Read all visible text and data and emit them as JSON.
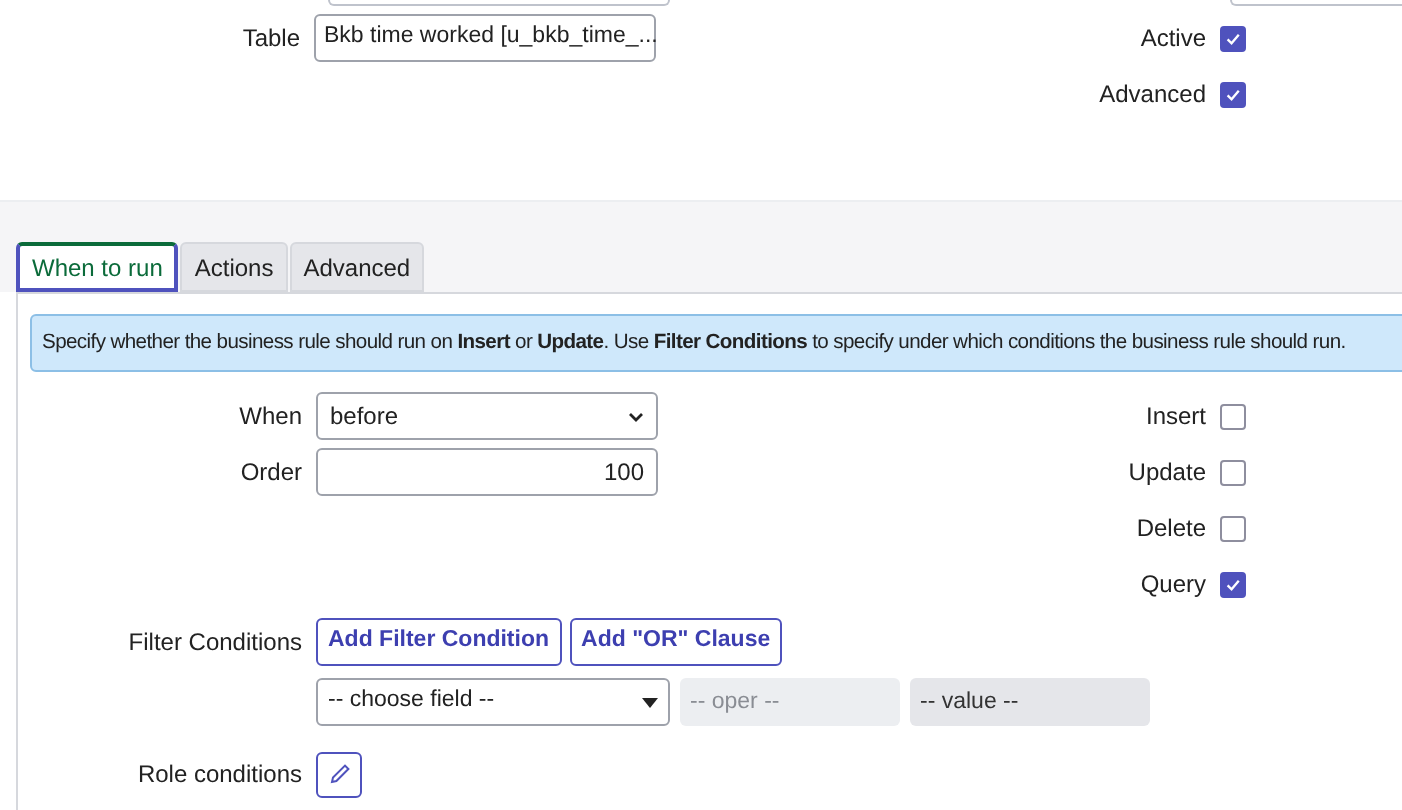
{
  "header_form": {
    "table": {
      "label": "Table",
      "value": "Bkb time worked [u_bkb_time_..."
    },
    "flags": [
      {
        "label": "Active",
        "checked": true
      },
      {
        "label": "Advanced",
        "checked": true
      }
    ]
  },
  "tabs": [
    {
      "label": "When to run",
      "selected": true
    },
    {
      "label": "Actions",
      "selected": false
    },
    {
      "label": "Advanced",
      "selected": false
    }
  ],
  "info": "Specify whether the business rule should run on **Insert** or **Update**. Use **Filter Conditions** to specify under which conditions the business rule should run.",
  "when": {
    "label": "When",
    "value": "before"
  },
  "order": {
    "label": "Order",
    "value": "100"
  },
  "operations": [
    {
      "label": "Insert",
      "checked": false
    },
    {
      "label": "Update",
      "checked": false
    },
    {
      "label": "Delete",
      "checked": false
    },
    {
      "label": "Query",
      "checked": true
    }
  ],
  "filter": {
    "label": "Filter Conditions",
    "buttons": [
      "Add Filter Condition",
      "Add \"OR\" Clause"
    ],
    "field": "-- choose field --",
    "operator_placeholder": "-- oper --",
    "value_placeholder": "-- value --"
  },
  "role_conditions": {
    "label": "Role conditions"
  }
}
